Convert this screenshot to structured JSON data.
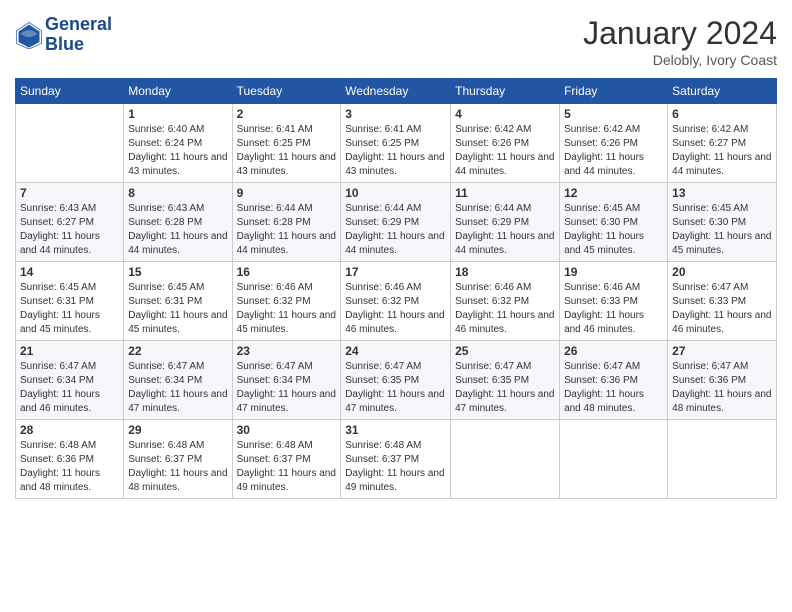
{
  "header": {
    "logo_line1": "General",
    "logo_line2": "Blue",
    "month": "January 2024",
    "location": "Delobly, Ivory Coast"
  },
  "weekdays": [
    "Sunday",
    "Monday",
    "Tuesday",
    "Wednesday",
    "Thursday",
    "Friday",
    "Saturday"
  ],
  "weeks": [
    [
      {
        "day": "",
        "sunrise": "",
        "sunset": "",
        "daylight": ""
      },
      {
        "day": "1",
        "sunrise": "Sunrise: 6:40 AM",
        "sunset": "Sunset: 6:24 PM",
        "daylight": "Daylight: 11 hours and 43 minutes."
      },
      {
        "day": "2",
        "sunrise": "Sunrise: 6:41 AM",
        "sunset": "Sunset: 6:25 PM",
        "daylight": "Daylight: 11 hours and 43 minutes."
      },
      {
        "day": "3",
        "sunrise": "Sunrise: 6:41 AM",
        "sunset": "Sunset: 6:25 PM",
        "daylight": "Daylight: 11 hours and 43 minutes."
      },
      {
        "day": "4",
        "sunrise": "Sunrise: 6:42 AM",
        "sunset": "Sunset: 6:26 PM",
        "daylight": "Daylight: 11 hours and 44 minutes."
      },
      {
        "day": "5",
        "sunrise": "Sunrise: 6:42 AM",
        "sunset": "Sunset: 6:26 PM",
        "daylight": "Daylight: 11 hours and 44 minutes."
      },
      {
        "day": "6",
        "sunrise": "Sunrise: 6:42 AM",
        "sunset": "Sunset: 6:27 PM",
        "daylight": "Daylight: 11 hours and 44 minutes."
      }
    ],
    [
      {
        "day": "7",
        "sunrise": "Sunrise: 6:43 AM",
        "sunset": "Sunset: 6:27 PM",
        "daylight": "Daylight: 11 hours and 44 minutes."
      },
      {
        "day": "8",
        "sunrise": "Sunrise: 6:43 AM",
        "sunset": "Sunset: 6:28 PM",
        "daylight": "Daylight: 11 hours and 44 minutes."
      },
      {
        "day": "9",
        "sunrise": "Sunrise: 6:44 AM",
        "sunset": "Sunset: 6:28 PM",
        "daylight": "Daylight: 11 hours and 44 minutes."
      },
      {
        "day": "10",
        "sunrise": "Sunrise: 6:44 AM",
        "sunset": "Sunset: 6:29 PM",
        "daylight": "Daylight: 11 hours and 44 minutes."
      },
      {
        "day": "11",
        "sunrise": "Sunrise: 6:44 AM",
        "sunset": "Sunset: 6:29 PM",
        "daylight": "Daylight: 11 hours and 44 minutes."
      },
      {
        "day": "12",
        "sunrise": "Sunrise: 6:45 AM",
        "sunset": "Sunset: 6:30 PM",
        "daylight": "Daylight: 11 hours and 45 minutes."
      },
      {
        "day": "13",
        "sunrise": "Sunrise: 6:45 AM",
        "sunset": "Sunset: 6:30 PM",
        "daylight": "Daylight: 11 hours and 45 minutes."
      }
    ],
    [
      {
        "day": "14",
        "sunrise": "Sunrise: 6:45 AM",
        "sunset": "Sunset: 6:31 PM",
        "daylight": "Daylight: 11 hours and 45 minutes."
      },
      {
        "day": "15",
        "sunrise": "Sunrise: 6:45 AM",
        "sunset": "Sunset: 6:31 PM",
        "daylight": "Daylight: 11 hours and 45 minutes."
      },
      {
        "day": "16",
        "sunrise": "Sunrise: 6:46 AM",
        "sunset": "Sunset: 6:32 PM",
        "daylight": "Daylight: 11 hours and 45 minutes."
      },
      {
        "day": "17",
        "sunrise": "Sunrise: 6:46 AM",
        "sunset": "Sunset: 6:32 PM",
        "daylight": "Daylight: 11 hours and 46 minutes."
      },
      {
        "day": "18",
        "sunrise": "Sunrise: 6:46 AM",
        "sunset": "Sunset: 6:32 PM",
        "daylight": "Daylight: 11 hours and 46 minutes."
      },
      {
        "day": "19",
        "sunrise": "Sunrise: 6:46 AM",
        "sunset": "Sunset: 6:33 PM",
        "daylight": "Daylight: 11 hours and 46 minutes."
      },
      {
        "day": "20",
        "sunrise": "Sunrise: 6:47 AM",
        "sunset": "Sunset: 6:33 PM",
        "daylight": "Daylight: 11 hours and 46 minutes."
      }
    ],
    [
      {
        "day": "21",
        "sunrise": "Sunrise: 6:47 AM",
        "sunset": "Sunset: 6:34 PM",
        "daylight": "Daylight: 11 hours and 46 minutes."
      },
      {
        "day": "22",
        "sunrise": "Sunrise: 6:47 AM",
        "sunset": "Sunset: 6:34 PM",
        "daylight": "Daylight: 11 hours and 47 minutes."
      },
      {
        "day": "23",
        "sunrise": "Sunrise: 6:47 AM",
        "sunset": "Sunset: 6:34 PM",
        "daylight": "Daylight: 11 hours and 47 minutes."
      },
      {
        "day": "24",
        "sunrise": "Sunrise: 6:47 AM",
        "sunset": "Sunset: 6:35 PM",
        "daylight": "Daylight: 11 hours and 47 minutes."
      },
      {
        "day": "25",
        "sunrise": "Sunrise: 6:47 AM",
        "sunset": "Sunset: 6:35 PM",
        "daylight": "Daylight: 11 hours and 47 minutes."
      },
      {
        "day": "26",
        "sunrise": "Sunrise: 6:47 AM",
        "sunset": "Sunset: 6:36 PM",
        "daylight": "Daylight: 11 hours and 48 minutes."
      },
      {
        "day": "27",
        "sunrise": "Sunrise: 6:47 AM",
        "sunset": "Sunset: 6:36 PM",
        "daylight": "Daylight: 11 hours and 48 minutes."
      }
    ],
    [
      {
        "day": "28",
        "sunrise": "Sunrise: 6:48 AM",
        "sunset": "Sunset: 6:36 PM",
        "daylight": "Daylight: 11 hours and 48 minutes."
      },
      {
        "day": "29",
        "sunrise": "Sunrise: 6:48 AM",
        "sunset": "Sunset: 6:37 PM",
        "daylight": "Daylight: 11 hours and 48 minutes."
      },
      {
        "day": "30",
        "sunrise": "Sunrise: 6:48 AM",
        "sunset": "Sunset: 6:37 PM",
        "daylight": "Daylight: 11 hours and 49 minutes."
      },
      {
        "day": "31",
        "sunrise": "Sunrise: 6:48 AM",
        "sunset": "Sunset: 6:37 PM",
        "daylight": "Daylight: 11 hours and 49 minutes."
      },
      {
        "day": "",
        "sunrise": "",
        "sunset": "",
        "daylight": ""
      },
      {
        "day": "",
        "sunrise": "",
        "sunset": "",
        "daylight": ""
      },
      {
        "day": "",
        "sunrise": "",
        "sunset": "",
        "daylight": ""
      }
    ]
  ]
}
